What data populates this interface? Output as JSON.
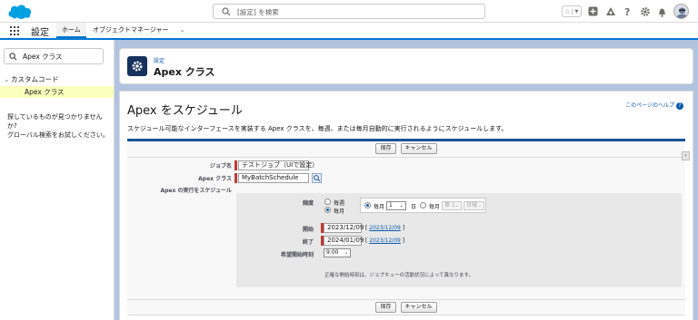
{
  "header": {
    "search_placeholder": "[設定] を検索"
  },
  "nav": {
    "app_name": "設定",
    "tabs": [
      {
        "label": "ホーム"
      },
      {
        "label": "オブジェクトマネージャー"
      }
    ]
  },
  "sidebar": {
    "search_value": "Apex クラス",
    "tree_parent": "カスタムコード",
    "tree_child": "Apex クラス",
    "help_text_1": "探しているものが見つかりませんか?",
    "help_text_2": "グローバル検索をお試しください。"
  },
  "page_header": {
    "breadcrumb": "設定",
    "title": "Apex クラス"
  },
  "content": {
    "title": "Apex をスケジュール",
    "help_link": "このページのヘルプ",
    "description": "スケジュール可能なインターフェースを実装する Apex クラスを、毎週、または毎月自動的に実行されるようにスケジュールします。",
    "buttons": {
      "save": "保存",
      "cancel": "キャンセル"
    },
    "fields": {
      "job_name_label": "ジョブ名",
      "job_name_value": "テストジョブ（UIで設定）",
      "apex_class_label": "Apex クラス",
      "apex_class_value": "MyBatchSchedule",
      "schedule_label": "Apex の実行をスケジュール"
    },
    "schedule": {
      "frequency_label": "頻度",
      "weekly": "毎週",
      "monthly": "毎月",
      "monthly_on": "毎月",
      "day_value": "1",
      "day_suffix": "日",
      "monthly_nth": "毎月",
      "nth_value": "第 1",
      "weekday_value": "日曜",
      "start_label": "開始",
      "start_value": "2023/12/09",
      "start_link": "2023/12/09",
      "end_label": "終了",
      "end_value": "2024/01/09",
      "end_link": "2023/12/09",
      "preferred_time_label": "希望開始時刻",
      "preferred_time_value": "9:00",
      "note": "正確な開始時刻は、ジョブキューの活動状況によって異なります。"
    }
  },
  "colors": {
    "brand_blue": "#0176d3",
    "form_header_bar": "#1b5297",
    "required_marker": "#c23934",
    "link": "#0b5cab",
    "highlight": "#faffbd"
  }
}
